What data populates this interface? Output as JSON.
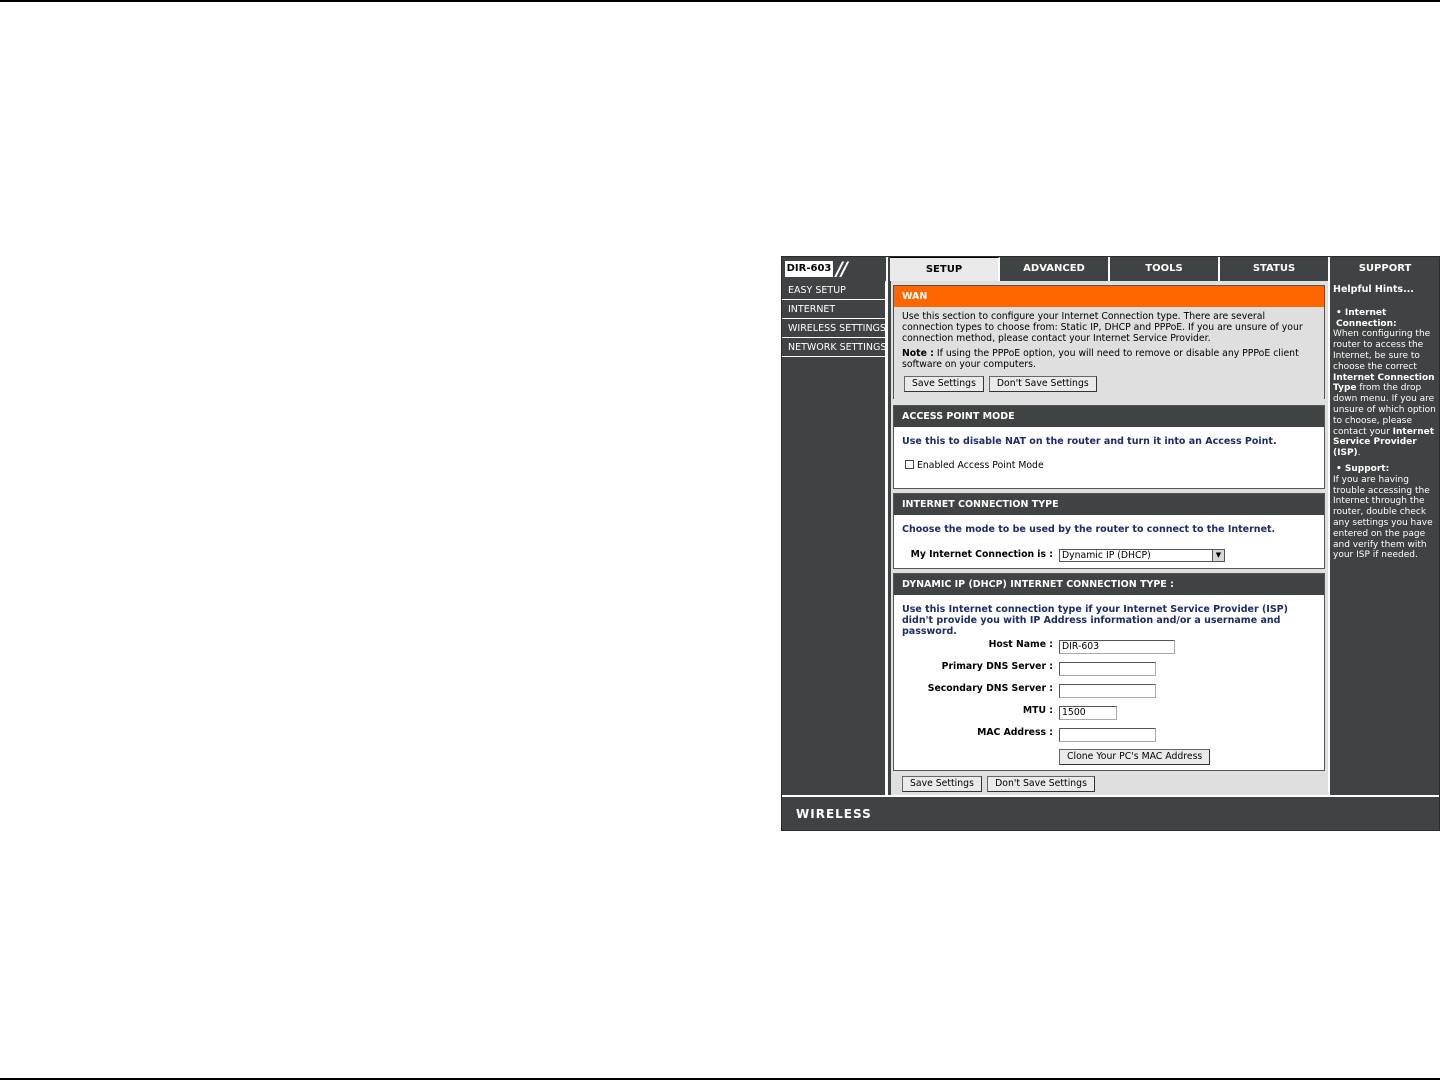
{
  "device": {
    "model": "DIR-603",
    "slashes": "//"
  },
  "tabs": [
    {
      "label": "SETUP",
      "active": true
    },
    {
      "label": "ADVANCED"
    },
    {
      "label": "TOOLS"
    },
    {
      "label": "STATUS"
    },
    {
      "label": "SUPPORT"
    }
  ],
  "sidebar": {
    "items": [
      {
        "label": "EASY SETUP"
      },
      {
        "label": "INTERNET"
      },
      {
        "label": "WIRELESS SETTINGS"
      },
      {
        "label": "NETWORK SETTINGS"
      }
    ]
  },
  "wan": {
    "title": "WAN",
    "description": "Use this section to configure your Internet Connection type. There are several connection types to choose from: Static IP, DHCP and PPPoE. If you are unsure of your connection method, please contact your Internet Service Provider.",
    "note_label": "Note :",
    "note_text": "If using the PPPoE option, you will need to remove or disable any PPPoE client software on your computers.",
    "save_label": "Save Settings",
    "dont_save_label": "Don't Save Settings"
  },
  "ap_mode": {
    "title": "ACCESS POINT MODE",
    "description": "Use this to disable NAT on the router and turn it into an Access Point.",
    "checkbox_label": "Enabled Access Point Mode",
    "checked": false
  },
  "connection_type": {
    "title": "INTERNET CONNECTION TYPE",
    "description": "Choose the mode to be used by the router to connect to the Internet.",
    "label": "My Internet Connection is :",
    "selected": "Dynamic IP (DHCP)"
  },
  "dhcp": {
    "title": "DYNAMIC IP (DHCP) INTERNET CONNECTION TYPE :",
    "description": "Use this Internet connection type if your Internet Service Provider (ISP) didn't provide you with IP Address information and/or a username and password.",
    "host_name_label": "Host Name :",
    "host_name_value": "DIR-603",
    "primary_dns_label": "Primary DNS Server :",
    "primary_dns_value": "",
    "secondary_dns_label": "Secondary DNS Server :",
    "secondary_dns_value": "",
    "mtu_label": "MTU :",
    "mtu_value": "1500",
    "mac_label": "MAC Address :",
    "mac_value": "",
    "clone_label": "Clone Your PC's MAC Address"
  },
  "bottom_actions": {
    "save_label": "Save Settings",
    "dont_save_label": "Don't Save Settings"
  },
  "hints": {
    "title": "Helpful Hints...",
    "item1_title": "Internet Connection:",
    "item1_text_a": "When configuring the router to access the Internet, be sure to choose the correct ",
    "item1_bold_a": "Internet Connection Type",
    "item1_text_b": " from the drop down menu. If you are unsure of which option to choose, please contact your ",
    "item1_bold_b": "Internet Service Provider (ISP)",
    "item1_text_c": ".",
    "item2_title": "Support:",
    "item2_text": "If you are having trouble accessing the Internet through the router, double check any settings you have entered on the page and verify them with your ISP if needed."
  },
  "footer": {
    "brand": "WIRELESS"
  }
}
